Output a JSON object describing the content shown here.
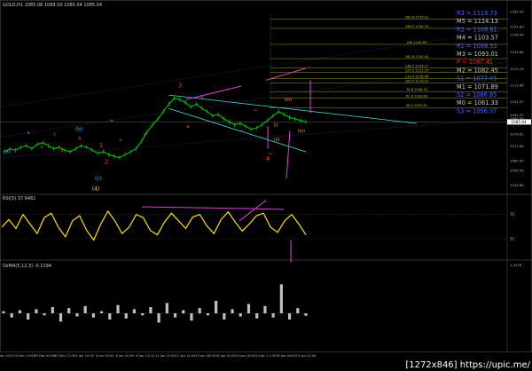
{
  "header": {
    "symbol_title": "GOLD,H1  1085.08 1089.50 1085.04 1085.04"
  },
  "rsi": {
    "title": "RSI(5) 37.6461",
    "levels": [
      70,
      32
    ],
    "value": 37.6461
  },
  "osma": {
    "title": "OsMA(5,12,3) -0.1194",
    "value": -0.1194,
    "level_label": "1.4478"
  },
  "watermark": "[1272x846] https://upic.me/",
  "colors": {
    "price": "#00c000",
    "channel": "#40e0e0",
    "fib": "#c8c820",
    "arrow": "#e040e0",
    "rsi": "#ffe000",
    "osma": "#c0c0c0",
    "grid": "#2a2a55"
  },
  "chart_data": [
    {
      "type": "line",
      "title": "GOLD,H1",
      "series": [
        {
          "name": "GOLD",
          "values": [
            1068,
            1070,
            1069,
            1071,
            1072,
            1070,
            1073,
            1074,
            1072,
            1070,
            1071,
            1069,
            1068,
            1070,
            1072,
            1071,
            1069,
            1067,
            1068,
            1066,
            1065,
            1064,
            1066,
            1068,
            1070,
            1075,
            1081,
            1086,
            1090,
            1095,
            1100,
            1104,
            1103,
            1101,
            1098,
            1100,
            1097,
            1095,
            1092,
            1093,
            1090,
            1088,
            1086,
            1087,
            1085,
            1083,
            1084,
            1086,
            1089,
            1092,
            1095,
            1093,
            1091,
            1090,
            1089,
            1088
          ]
        }
      ],
      "y_axis_ticks": [
        "1162.00",
        "1151.83",
        "1146.44",
        "1134.84",
        "1123.74",
        "1112.66",
        "1101.57",
        "1092.57",
        "1090.30",
        "1079.81",
        "1071.84",
        "1062.00",
        "1055.50",
        "1045.80"
      ],
      "fib_levels": [
        {
          "label": "261.8  1157.01",
          "value": 1157.01
        },
        {
          "label": "238.2  1150.74",
          "value": 1150.74
        },
        {
          "label": "200  1140.03",
          "value": 1140.03
        },
        {
          "label": "161.8  1130.44",
          "value": 1130.44
        },
        {
          "label": "138.2  1124.17",
          "value": 1124.17
        },
        {
          "label": "127.2  1121.25",
          "value": 1121.25
        },
        {
          "label": "112.0  1116.98",
          "value": 1116.98
        },
        {
          "label": "100.0  1114.02",
          "value": 1114.02
        },
        {
          "label": "78.6  1108.34",
          "value": 1108.34
        },
        {
          "label": "61.8  1103.89",
          "value": 1103.89
        },
        {
          "label": "38.2  1097.61",
          "value": 1097.61
        }
      ],
      "pivots": [
        {
          "label": "R3",
          "value": "1118.73",
          "color": "#4466ff"
        },
        {
          "label": "M5",
          "value": "1114.13",
          "color": "#cccccc"
        },
        {
          "label": "R2",
          "value": "1108.61",
          "color": "#4466ff"
        },
        {
          "label": "M4",
          "value": "1103.57",
          "color": "#cccccc"
        },
        {
          "label": "R1",
          "value": "1098.53",
          "color": "#4466ff"
        },
        {
          "label": "M3",
          "value": "1093.01",
          "color": "#cccccc"
        },
        {
          "label": "P",
          "value": "1087.41",
          "color": "#ff2020"
        },
        {
          "label": "M2",
          "value": "1082.45",
          "color": "#cccccc"
        },
        {
          "label": "S1",
          "value": "1077.45",
          "color": "#4466ff"
        },
        {
          "label": "M1",
          "value": "1071.89",
          "color": "#cccccc"
        },
        {
          "label": "S2",
          "value": "1066.85",
          "color": "#4466ff"
        },
        {
          "label": "M0",
          "value": "1061.33",
          "color": "#cccccc"
        },
        {
          "label": "S3",
          "value": "1056.37",
          "color": "#4466ff"
        }
      ],
      "wave_labels": [
        "(a)",
        "(b)",
        "(c)",
        "(4)",
        "1",
        "2",
        "3",
        "4",
        "a",
        "b",
        "c",
        "d",
        "e",
        "a",
        "b",
        "c",
        "(i)",
        "(ii)",
        "(iii)",
        "(iv)",
        "w",
        "x",
        "y",
        "iii",
        "iv",
        "a",
        "b",
        "c"
      ],
      "current_price": "1085.04"
    },
    {
      "type": "line",
      "title": "RSI(5) 37.6461",
      "series": [
        {
          "name": "RSI",
          "values": [
            50,
            62,
            48,
            70,
            55,
            40,
            65,
            72,
            50,
            35,
            60,
            68,
            45,
            30,
            55,
            75,
            60,
            40,
            50,
            70,
            65,
            45,
            38,
            58,
            72,
            60,
            48,
            66,
            70,
            52,
            40,
            62,
            74,
            58,
            44,
            55,
            68,
            72,
            50,
            42,
            60,
            70,
            55,
            38
          ]
        }
      ],
      "ylim": [
        0,
        100
      ]
    },
    {
      "type": "bar",
      "title": "OsMA(5,12,3) -0.1194",
      "values": [
        0.1,
        -0.2,
        0.15,
        -0.3,
        0.2,
        -0.1,
        0.3,
        -0.4,
        0.25,
        -0.15,
        0.35,
        -0.2,
        0.1,
        -0.3,
        0.4,
        -0.25,
        0.2,
        -0.1,
        0.3,
        -0.45,
        0.5,
        -0.2,
        0.15,
        -0.35,
        0.25,
        -0.1,
        0.6,
        -0.3,
        0.2,
        -0.15,
        0.45,
        -0.25,
        0.35,
        -0.2,
        1.4,
        -0.3,
        0.25,
        -0.12
      ],
      "ylim": [
        -1.5,
        1.5
      ]
    }
  ],
  "x_axis": [
    "3 Dec 2015",
    "24 Dec 19:00",
    "29 Dec 00:00",
    "30 Dec 17:00",
    "4 Jan 10:00",
    "6 Jan 03:00",
    "6 Jan 20:00",
    "8 Jan 13:00",
    "11 Jan 22:00",
    "12 Jan 15:00",
    "13 Jan 08:00",
    "14 Jan 01:00",
    "14 Jan 18:00",
    "15 Jan 11:00",
    "18 Jan 04:00",
    "15 Jan 22:00"
  ]
}
